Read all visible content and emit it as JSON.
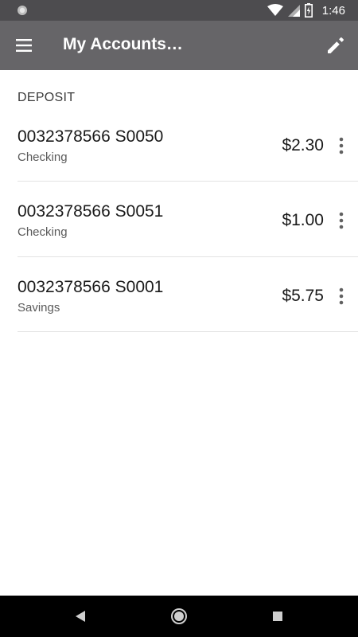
{
  "status_bar": {
    "time": "1:46",
    "left_icon": "circle-notification-icon",
    "icons": [
      "wifi-icon",
      "cell-signal-icon",
      "battery-charging-icon"
    ]
  },
  "app_bar": {
    "title": "My Accounts…",
    "menu_icon": "hamburger-menu-icon",
    "edit_icon": "pencil-edit-icon",
    "background": "#666568"
  },
  "section": {
    "header": "DEPOSIT"
  },
  "accounts": [
    {
      "number": "0032378566 S0050",
      "type": "Checking",
      "balance": "$2.30"
    },
    {
      "number": "0032378566 S0051",
      "type": "Checking",
      "balance": "$1.00"
    },
    {
      "number": "0032378566 S0001",
      "type": "Savings",
      "balance": "$5.75"
    }
  ],
  "nav_bar": {
    "buttons": [
      "back-icon",
      "home-icon",
      "recents-icon"
    ]
  }
}
